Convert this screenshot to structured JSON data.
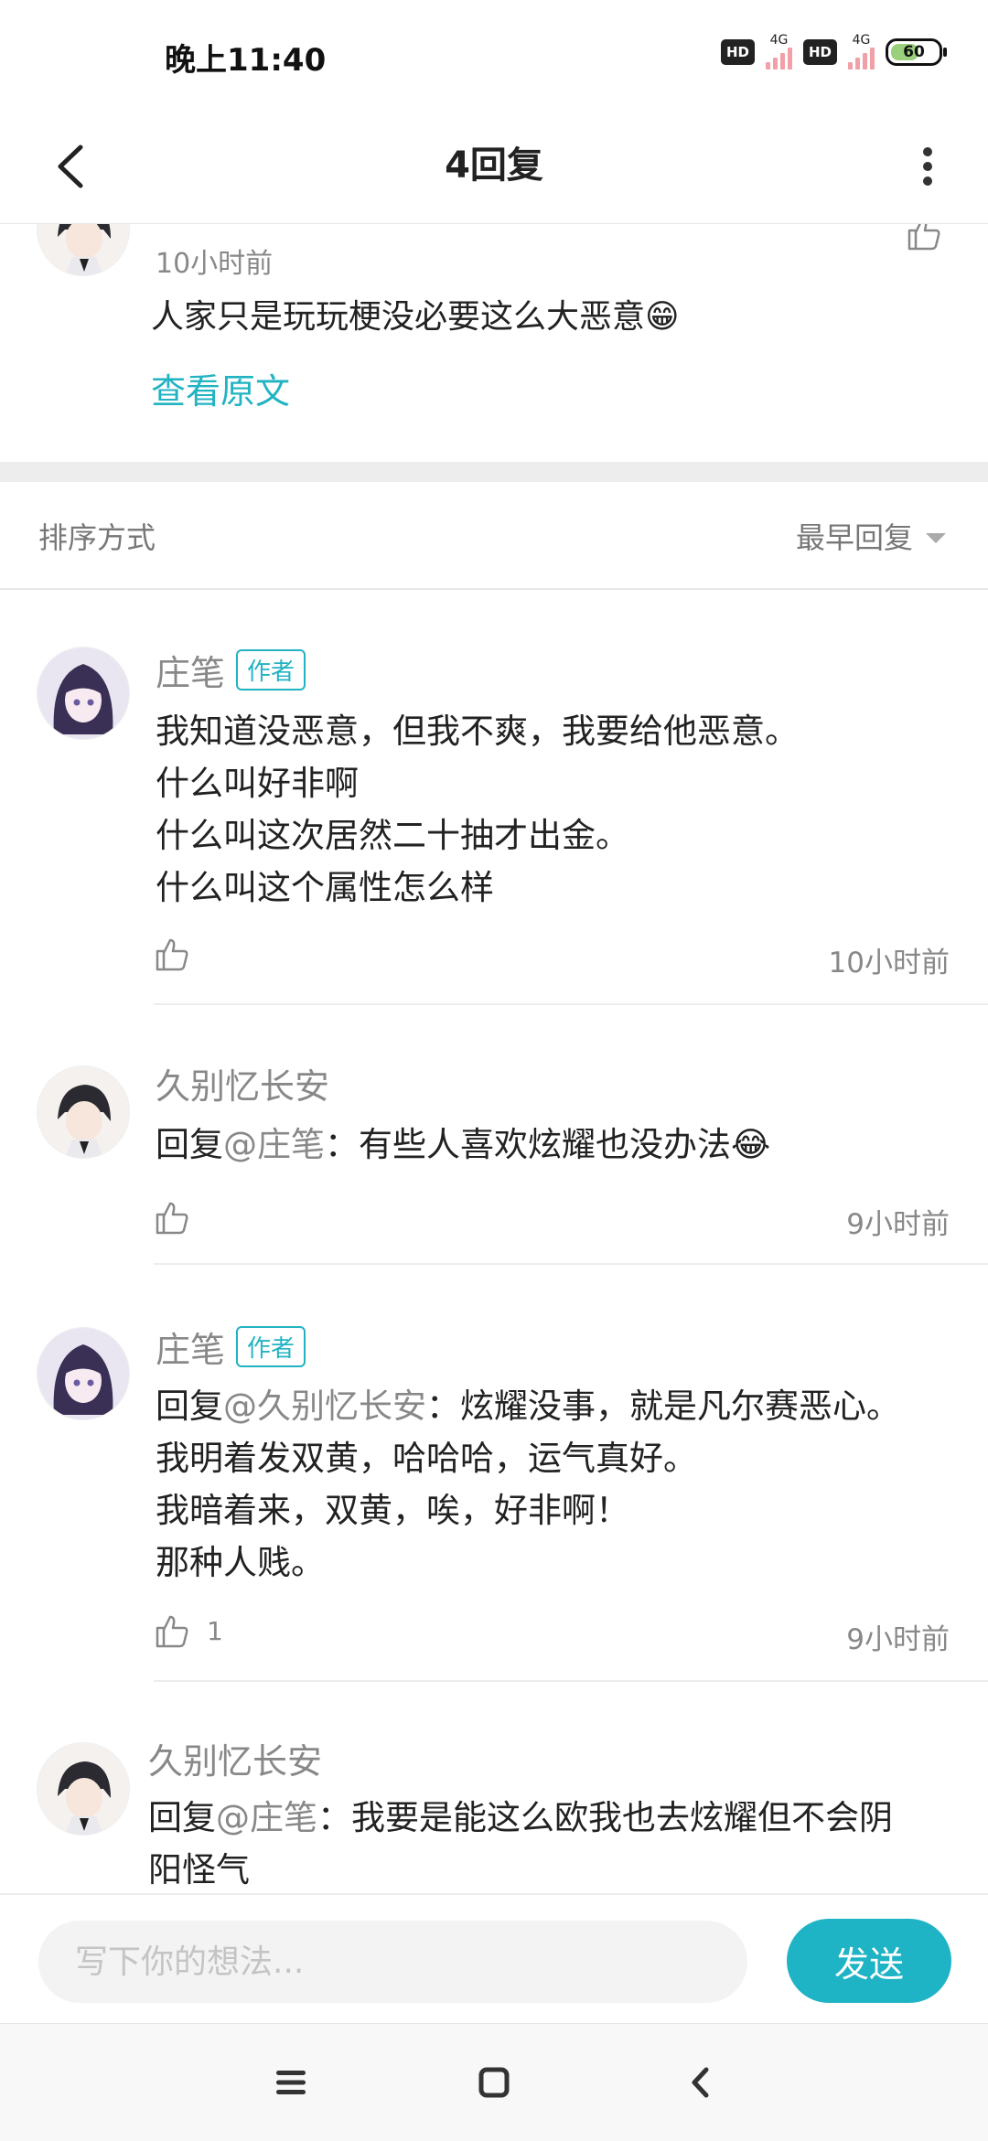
{
  "status_bar": {
    "time": "晚上11:40",
    "hd_label": "HD",
    "net_label": "4G",
    "battery_level": 60,
    "battery_text": "60"
  },
  "nav": {
    "title": "4回复"
  },
  "parent_comment": {
    "time": "10小时前",
    "text": "人家只是玩玩梗没必要这么大恶意😁",
    "view_original_label": "查看原文"
  },
  "sort": {
    "label": "排序方式",
    "selected": "最早回复"
  },
  "author_badge_label": "作者",
  "replies": [
    {
      "name": "庄笔",
      "is_author": true,
      "mention": "",
      "lines": [
        "我知道没恶意，但我不爽，我要给他恶意。",
        "什么叫好非啊",
        "什么叫这次居然二十抽才出金。",
        "什么叫这个属性怎么样"
      ],
      "likes": "",
      "time": "10小时前"
    },
    {
      "name": "久别忆长安",
      "is_author": false,
      "prefix": "回复",
      "mention": "@庄笔",
      "lines": [
        "：有些人喜欢炫耀也没办法😂"
      ],
      "likes": "",
      "time": "9小时前"
    },
    {
      "name": "庄笔",
      "is_author": true,
      "prefix": "回复",
      "mention": "@久别忆长安",
      "lines": [
        "：炫耀没事，就是凡尔赛恶心。",
        "我明着发双黄，哈哈哈，运气真好。",
        "我暗着来，双黄，唉，好非啊！",
        "那种人贱。"
      ],
      "likes": "1",
      "time": "9小时前"
    },
    {
      "name": "久别忆长安",
      "is_author": false,
      "prefix": "回复",
      "mention": "@庄笔",
      "lines": [
        "：我要是能这么欧我也去炫耀但不会阴",
        "阳怪气"
      ],
      "likes": "",
      "time": ""
    }
  ],
  "input": {
    "placeholder": "写下你的想法...",
    "send_label": "发送"
  },
  "colors": {
    "accent": "#1fb3c6",
    "text_primary": "#222222",
    "text_secondary": "#888888",
    "divider": "#ededed"
  },
  "icons": {
    "back": "back-arrow-icon",
    "more": "more-vertical-icon",
    "like": "thumbs-up-icon",
    "menu": "menu-icon",
    "home": "home-square-icon",
    "sys_back": "back-chevron-icon"
  }
}
